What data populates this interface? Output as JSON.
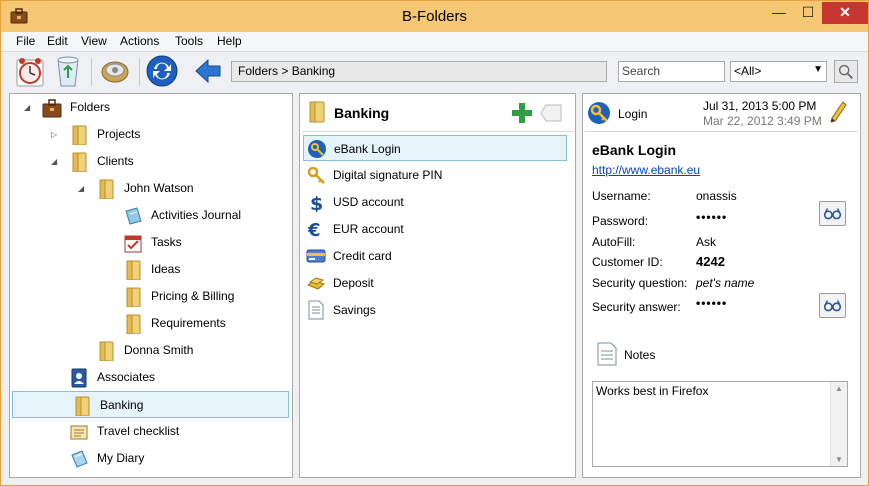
{
  "window": {
    "title": "B-Folders",
    "min": "—",
    "max": "☐",
    "close": "✕"
  },
  "menu": [
    "File",
    "Edit",
    "View",
    "Actions",
    "Tools",
    "Help"
  ],
  "toolbar": {
    "breadcrumb": "Folders > Banking",
    "search_placeholder": "Search",
    "filter_value": "<All>",
    "filter_caret": "▼"
  },
  "tree": [
    {
      "label": "Folders",
      "level": 0,
      "expanded": true,
      "icon": "briefcase-icon"
    },
    {
      "label": "Projects",
      "level": 1,
      "expanded": false,
      "icon": "folder-icon"
    },
    {
      "label": "Clients",
      "level": 1,
      "expanded": true,
      "icon": "folder-icon"
    },
    {
      "label": "John Watson",
      "level": 2,
      "expanded": true,
      "icon": "folder-icon"
    },
    {
      "label": "Activities Journal",
      "level": 3,
      "icon": "journal-icon"
    },
    {
      "label": "Tasks",
      "level": 3,
      "icon": "tasks-icon"
    },
    {
      "label": "Ideas",
      "level": 3,
      "icon": "folder-icon"
    },
    {
      "label": "Pricing & Billing",
      "level": 3,
      "icon": "folder-icon"
    },
    {
      "label": "Requirements",
      "level": 3,
      "icon": "folder-icon"
    },
    {
      "label": "Donna Smith",
      "level": 2,
      "icon": "folder-icon"
    },
    {
      "label": "Associates",
      "level": 1,
      "icon": "contacts-icon"
    },
    {
      "label": "Banking",
      "level": 1,
      "icon": "folder-icon",
      "selected": true
    },
    {
      "label": "Travel checklist",
      "level": 1,
      "icon": "checklist-icon"
    },
    {
      "label": "My Diary",
      "level": 1,
      "icon": "diary-icon"
    }
  ],
  "list": {
    "header": "Banking",
    "items": [
      {
        "label": "eBank Login",
        "icon": "login-key-icon",
        "selected": true
      },
      {
        "label": "Digital signature PIN",
        "icon": "key-icon"
      },
      {
        "label": "USD account",
        "icon": "dollar-icon"
      },
      {
        "label": "EUR account",
        "icon": "euro-icon"
      },
      {
        "label": "Credit card",
        "icon": "credit-card-icon"
      },
      {
        "label": "Deposit",
        "icon": "gold-icon"
      },
      {
        "label": "Savings",
        "icon": "document-icon"
      }
    ]
  },
  "detail": {
    "type": "Login",
    "date_modified": "Jul 31, 2013 5:00 PM",
    "date_created": "Mar 22, 2012 3:49 PM",
    "title": "eBank Login",
    "url": "http://www.ebank.eu",
    "fields": [
      {
        "label": "Username:",
        "value": "onassis"
      },
      {
        "label": "Password:",
        "value": "••••••"
      },
      {
        "label": "AutoFill:",
        "value": "Ask"
      },
      {
        "label": "Customer ID:",
        "value": "4242"
      },
      {
        "label": "Security question:",
        "value": "pet's name"
      },
      {
        "label": "Security answer:",
        "value": "••••••"
      }
    ],
    "notes_label": "Notes",
    "notes_text": "Works best in Firefox"
  },
  "colors": {
    "titlebar": "#f7c873",
    "close": "#c7372f",
    "selection_bg": "#e5f3fb",
    "selection_border": "#86bfe0",
    "link": "#0645ad"
  }
}
